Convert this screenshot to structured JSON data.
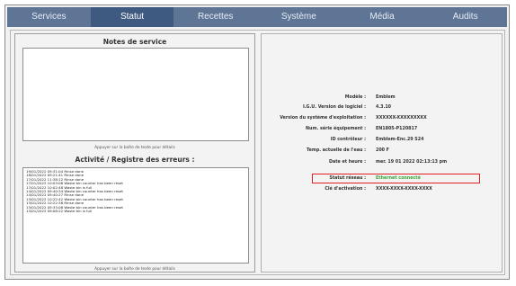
{
  "nav": {
    "tabs": [
      {
        "label": "Services"
      },
      {
        "label": "Statut"
      },
      {
        "label": "Recettes"
      },
      {
        "label": "Système"
      },
      {
        "label": "Média"
      },
      {
        "label": "Audits"
      }
    ]
  },
  "notes": {
    "title": "Notes de service",
    "hint": "Appuyer sur la boîte de texte pour détails"
  },
  "log": {
    "title": "Activité / Registre des erreurs :",
    "hint": "Appuyer sur la boîte de texte pour détails",
    "lines": [
      "19/01/2022 09:31:04 Rinse done",
      "18/01/2022 09:21:41 Rinse done",
      "17/01/2022 11:38:12 Rinse done",
      "17/01/2022 10:03:08 Waste bin counter has been reset",
      "17/01/2022 10:02:48 Waste bin is full",
      "14/01/2022 09:40:34 Waste bin counter has been reset",
      "14/01/2022 09:40:27 Rinse done",
      "13/01/2022 10:22:42 Waste bin counter has been reset",
      "13/01/2022 10:22:38 Rinse done",
      "13/01/2022 09:33:08 Waste bin counter has been reset",
      "13/01/2022 09:08:22 Waste bin is full"
    ]
  },
  "status": {
    "rows": [
      {
        "label": "Modèle :",
        "value": "Emblem"
      },
      {
        "label": "I.G.U. Version de logiciel :",
        "value": "4.3.10"
      },
      {
        "label": "Version du système d'exploitation :",
        "value": "XXXXXX-XXXXXXXXX"
      },
      {
        "label": "Num. série équipement :",
        "value": "EN1805-P120817"
      },
      {
        "label": "ID contrôleur :",
        "value": "Emblem-Enc.29 S24"
      },
      {
        "label": "Temp. actuelle de l'eau :",
        "value": "200 F"
      },
      {
        "label": "Date et heure :",
        "value": "mer. 19 01 2022 02:13:13 pm"
      },
      {
        "label": "Statut réseau :",
        "value": "Ethernet connecté"
      },
      {
        "label": "Clé d'activation :",
        "value": "XXXX-XXXX-XXXX-XXXX"
      }
    ],
    "network_value_color": "#3aa53a",
    "highlight_color": "#e02020"
  }
}
